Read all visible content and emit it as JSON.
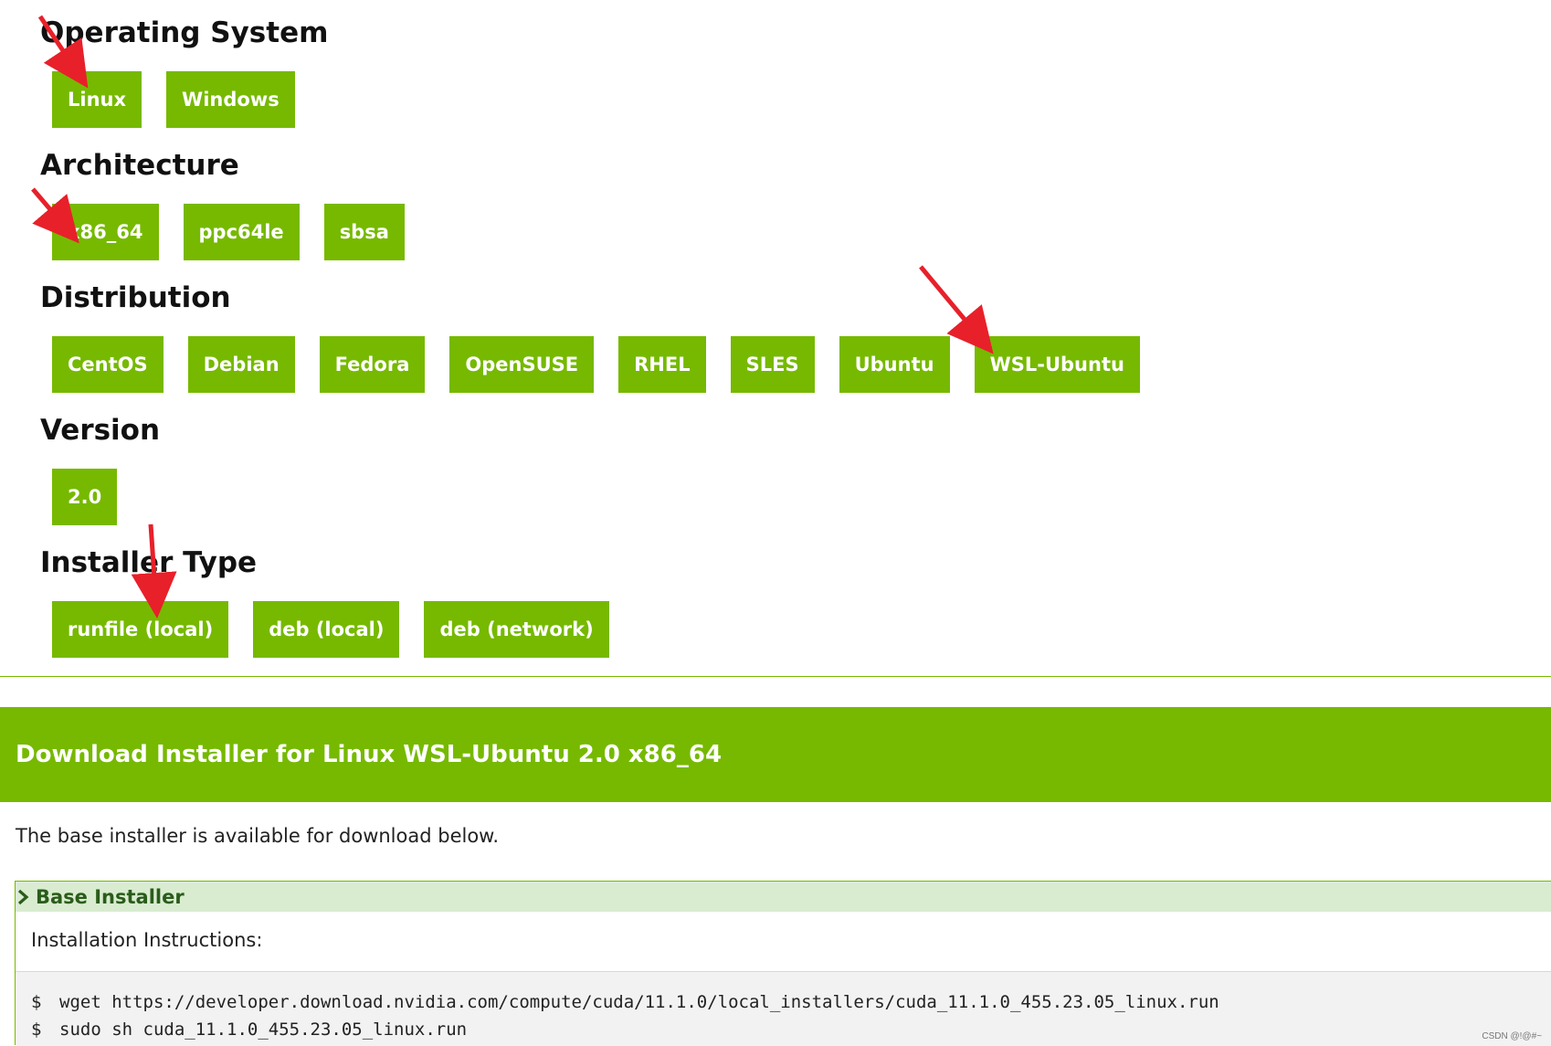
{
  "sections": {
    "os": {
      "title": "Operating System",
      "options": [
        "Linux",
        "Windows"
      ]
    },
    "arch": {
      "title": "Architecture",
      "options": [
        "x86_64",
        "ppc64le",
        "sbsa"
      ]
    },
    "distro": {
      "title": "Distribution",
      "options": [
        "CentOS",
        "Debian",
        "Fedora",
        "OpenSUSE",
        "RHEL",
        "SLES",
        "Ubuntu",
        "WSL-Ubuntu"
      ]
    },
    "version": {
      "title": "Version",
      "options": [
        "2.0"
      ]
    },
    "installer": {
      "title": "Installer Type",
      "options": [
        "runfile (local)",
        "deb (local)",
        "deb (network)"
      ]
    }
  },
  "download": {
    "banner": "Download Installer for Linux WSL-Ubuntu 2.0 x86_64",
    "base_text": "The base installer is available for download below.",
    "base_installer_label": "Base Installer",
    "instructions_label": "Installation Instructions:",
    "commands": [
      {
        "prompt": "$",
        "cmd": "wget https://developer.download.nvidia.com/compute/cuda/11.1.0/local_installers/cuda_11.1.0_455.23.05_linux.run"
      },
      {
        "prompt": "$",
        "cmd": "sudo sh cuda_11.1.0_455.23.05_linux.run"
      }
    ]
  },
  "watermark": "CSDN @!@#~",
  "colors": {
    "accent": "#76b900",
    "annotation": "#e8202a"
  }
}
